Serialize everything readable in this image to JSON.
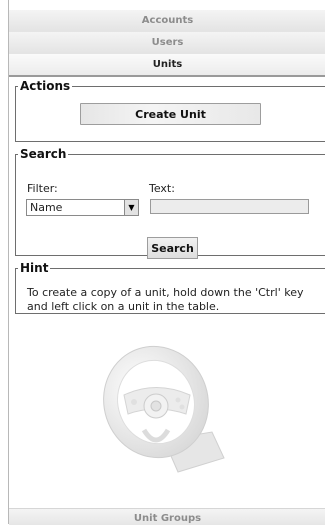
{
  "nav": {
    "tabs": [
      {
        "label": "Accounts",
        "active": false
      },
      {
        "label": "Users",
        "active": false
      },
      {
        "label": "Units",
        "active": true
      }
    ],
    "bottom_tab": "Unit Groups"
  },
  "actions": {
    "legend": "Actions",
    "create_button": "Create Unit"
  },
  "search": {
    "legend": "Search",
    "filter_label": "Filter:",
    "filter_value": "Name",
    "text_label": "Text:",
    "text_value": "",
    "search_button": "Search"
  },
  "hint": {
    "legend": "Hint",
    "text": "To create a copy of a unit, hold down the 'Ctrl' key and left click on a unit in the table."
  },
  "illustration": {
    "icon": "steering-wheel-icon"
  }
}
